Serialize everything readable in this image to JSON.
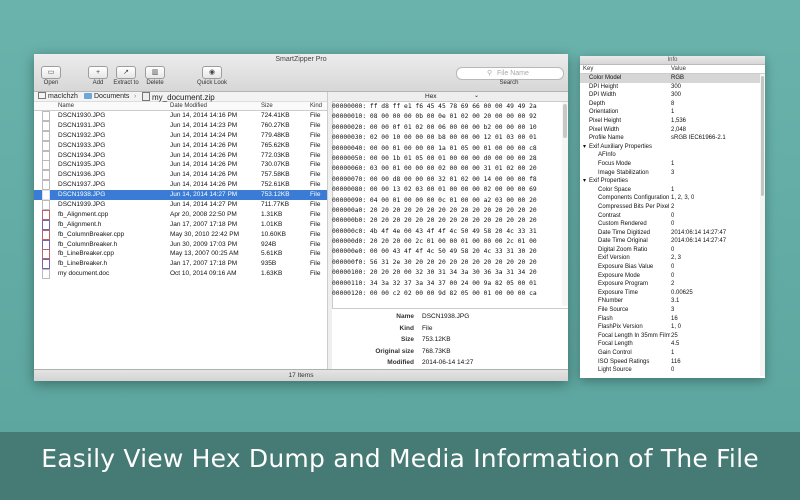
{
  "caption": "Easily View Hex Dump and Media Information of The File",
  "window": {
    "title": "SmartZipper Pro",
    "toolbar": [
      {
        "label": "Open",
        "icon": "folder-icon",
        "glyph": "▭"
      },
      {
        "label": "Add",
        "icon": "plus-icon",
        "glyph": "+"
      },
      {
        "label": "Extract to",
        "icon": "extract-icon",
        "glyph": "↗"
      },
      {
        "label": "Delete",
        "icon": "trash-icon",
        "glyph": "▥"
      },
      {
        "label": "Quick Look",
        "icon": "eye-icon",
        "glyph": "◉"
      }
    ],
    "search": {
      "placeholder": "File Name",
      "label": "Search"
    },
    "path": [
      "macIchzh",
      "Documents",
      "my_document.zip"
    ],
    "columns": {
      "name": "Name",
      "date": "Date Modified",
      "size": "Size",
      "kind": "Kind"
    },
    "files": [
      {
        "name": "DSCN1930.JPG",
        "date": "Jun 14, 2014 14:16 PM",
        "size": "724.41KB",
        "kind": "File",
        "type": "jpg"
      },
      {
        "name": "DSCN1931.JPG",
        "date": "Jun 14, 2014 14:23 PM",
        "size": "760.27KB",
        "kind": "File",
        "type": "jpg"
      },
      {
        "name": "DSCN1932.JPG",
        "date": "Jun 14, 2014 14:24 PM",
        "size": "779.48KB",
        "kind": "File",
        "type": "jpg"
      },
      {
        "name": "DSCN1933.JPG",
        "date": "Jun 14, 2014 14:26 PM",
        "size": "765.62KB",
        "kind": "File",
        "type": "jpg"
      },
      {
        "name": "DSCN1934.JPG",
        "date": "Jun 14, 2014 14:26 PM",
        "size": "772.03KB",
        "kind": "File",
        "type": "jpg"
      },
      {
        "name": "DSCN1935.JPG",
        "date": "Jun 14, 2014 14:26 PM",
        "size": "730.07KB",
        "kind": "File",
        "type": "jpg"
      },
      {
        "name": "DSCN1936.JPG",
        "date": "Jun 14, 2014 14:26 PM",
        "size": "757.58KB",
        "kind": "File",
        "type": "jpg"
      },
      {
        "name": "DSCN1937.JPG",
        "date": "Jun 14, 2014 14:26 PM",
        "size": "752.61KB",
        "kind": "File",
        "type": "jpg"
      },
      {
        "name": "DSCN1938.JPG",
        "date": "Jun 14, 2014 14:27 PM",
        "size": "753.12KB",
        "kind": "File",
        "type": "jpg",
        "selected": true
      },
      {
        "name": "DSCN1939.JPG",
        "date": "Jun 14, 2014 14:27 PM",
        "size": "711.77KB",
        "kind": "File",
        "type": "jpg"
      },
      {
        "name": "fb_Alignment.cpp",
        "date": "Apr 20, 2008 22:50 PM",
        "size": "1.31KB",
        "kind": "File",
        "type": "cpp"
      },
      {
        "name": "fb_Alignment.h",
        "date": "Jan 17, 2007 17:18 PM",
        "size": "1.01KB",
        "kind": "File",
        "type": "h"
      },
      {
        "name": "fb_ColumnBreaker.cpp",
        "date": "May 30, 2010 22:42 PM",
        "size": "10.60KB",
        "kind": "File",
        "type": "cpp"
      },
      {
        "name": "fb_ColumnBreaker.h",
        "date": "Jun 30, 2009 17:03 PM",
        "size": "924B",
        "kind": "File",
        "type": "h"
      },
      {
        "name": "fb_LineBreaker.cpp",
        "date": "May 13, 2007 00:25 AM",
        "size": "5.61KB",
        "kind": "File",
        "type": "cpp"
      },
      {
        "name": "fb_LineBreaker.h",
        "date": "Jan 17, 2007 17:18 PM",
        "size": "935B",
        "kind": "File",
        "type": "h"
      },
      {
        "name": "my document.doc",
        "date": "Oct 10, 2014 09:16 AM",
        "size": "1.63KB",
        "kind": "File",
        "type": "doc"
      }
    ],
    "hex": {
      "mode": "Hex",
      "lines": [
        "00000000: ff d8 ff e1 f6 45 45 78 69 66 00 00 49 49 2a",
        "00000010: 08 00 00 00 0b 00 0e 01 02 00 20 00 00 00 92",
        "00000020: 00 00 0f 01 02 00 06 00 00 00 b2 00 00 00 10",
        "00000030: 02 00 10 00 00 00 b8 00 00 00 12 01 03 00 01",
        "00000040: 00 00 01 00 00 00 1a 01 05 00 01 00 00 00 c8",
        "00000050: 00 00 1b 01 05 00 01 00 00 00 d0 00 00 00 28",
        "00000060: 03 00 01 00 00 00 02 00 00 00 31 01 02 00 20",
        "00000070: 00 00 d8 00 00 00 32 01 02 00 14 00 00 00 f8",
        "00000080: 00 00 13 02 03 00 01 00 00 00 02 00 00 00 69",
        "00000090: 04 00 01 00 00 00 0c 01 00 00 a2 03 00 00 20",
        "000000a0: 20 20 20 20 20 20 20 20 20 20 20 20 20 20 20",
        "000000b0: 20 20 20 20 20 20 20 20 20 20 20 20 20 20 20",
        "000000c0: 4b 4f 4e 00 43 4f 4f 4c 50 49 58 20 4c 33 31",
        "000000d0: 20 20 20 00 2c 01 00 00 01 00 00 00 2c 01 00",
        "000000e0: 00 00 43 4f 4f 4c 50 49 58 20 4c 33 31 30 20",
        "000000f0: 56 31 2e 30 20 20 20 20 20 20 20 20 20 20 20",
        "00000100: 20 20 20 00 32 30 31 34 3a 30 36 3a 31 34 20",
        "00000110: 34 3a 32 37 3a 34 37 00 24 00 9a 82 05 00 01",
        "00000120: 00 00 c2 02 00 00 9d 82 05 00 01 00 00 00 ca"
      ]
    },
    "details": [
      {
        "key": "Name",
        "value": "DSCN1938.JPG"
      },
      {
        "key": "Kind",
        "value": "File"
      },
      {
        "key": "Size",
        "value": "753.12KB"
      },
      {
        "key": "Original size",
        "value": "768.73KB"
      },
      {
        "key": "Modified",
        "value": "2014-06-14 14:27"
      }
    ],
    "status": "17 Items"
  },
  "info": {
    "title": "Info",
    "columns": {
      "key": "Key",
      "value": "Value"
    },
    "rows": [
      {
        "key": "Color Model",
        "value": "RGB",
        "level": 1,
        "selected": true
      },
      {
        "key": "DPI Height",
        "value": "300",
        "level": 1
      },
      {
        "key": "DPI Width",
        "value": "300",
        "level": 1
      },
      {
        "key": "Depth",
        "value": "8",
        "level": 1
      },
      {
        "key": "Orientation",
        "value": "1",
        "level": 1
      },
      {
        "key": "Pixel Height",
        "value": "1,536",
        "level": 1
      },
      {
        "key": "Pixel Width",
        "value": "2,048",
        "level": 1
      },
      {
        "key": "Profile Name",
        "value": "sRGB IEC61966-2.1",
        "level": 1
      },
      {
        "key": "Exif Auxiliary Properties",
        "value": "",
        "level": 0
      },
      {
        "key": "AFInfo",
        "value": "",
        "level": 2
      },
      {
        "key": "Focus Mode",
        "value": "1",
        "level": 2
      },
      {
        "key": "Image Stabilization",
        "value": "3",
        "level": 2
      },
      {
        "key": "Exif Properties",
        "value": "",
        "level": 0
      },
      {
        "key": "Color Space",
        "value": "1",
        "level": 2
      },
      {
        "key": "Components Configuration",
        "value": "1, 2, 3, 0",
        "level": 2
      },
      {
        "key": "Compressed Bits Per Pixel",
        "value": "2",
        "level": 2
      },
      {
        "key": "Contrast",
        "value": "0",
        "level": 2
      },
      {
        "key": "Custom Rendered",
        "value": "0",
        "level": 2
      },
      {
        "key": "Date Time Digitized",
        "value": "2014:06:14 14:27:47",
        "level": 2
      },
      {
        "key": "Date Time Original",
        "value": "2014:06:14 14:27:47",
        "level": 2
      },
      {
        "key": "Digital Zoom Ratio",
        "value": "0",
        "level": 2
      },
      {
        "key": "Exif Version",
        "value": "2, 3",
        "level": 2
      },
      {
        "key": "Exposure Bias Value",
        "value": "0",
        "level": 2
      },
      {
        "key": "Exposure Mode",
        "value": "0",
        "level": 2
      },
      {
        "key": "Exposure Program",
        "value": "2",
        "level": 2
      },
      {
        "key": "Exposure Time",
        "value": "0.00625",
        "level": 2
      },
      {
        "key": "FNumber",
        "value": "3.1",
        "level": 2
      },
      {
        "key": "File Source",
        "value": "3",
        "level": 2
      },
      {
        "key": "Flash",
        "value": "16",
        "level": 2
      },
      {
        "key": "FlashPix Version",
        "value": "1, 0",
        "level": 2
      },
      {
        "key": "Focal Length In 35mm Film",
        "value": "25",
        "level": 2
      },
      {
        "key": "Focal Length",
        "value": "4.5",
        "level": 2
      },
      {
        "key": "Gain Control",
        "value": "1",
        "level": 2
      },
      {
        "key": "ISO Speed Ratings",
        "value": "116",
        "level": 2
      },
      {
        "key": "Light Source",
        "value": "0",
        "level": 2
      }
    ]
  },
  "colors": {
    "accent": "#3a7bd5",
    "background": "#5fa9a2",
    "caption_band": "#467a74"
  }
}
